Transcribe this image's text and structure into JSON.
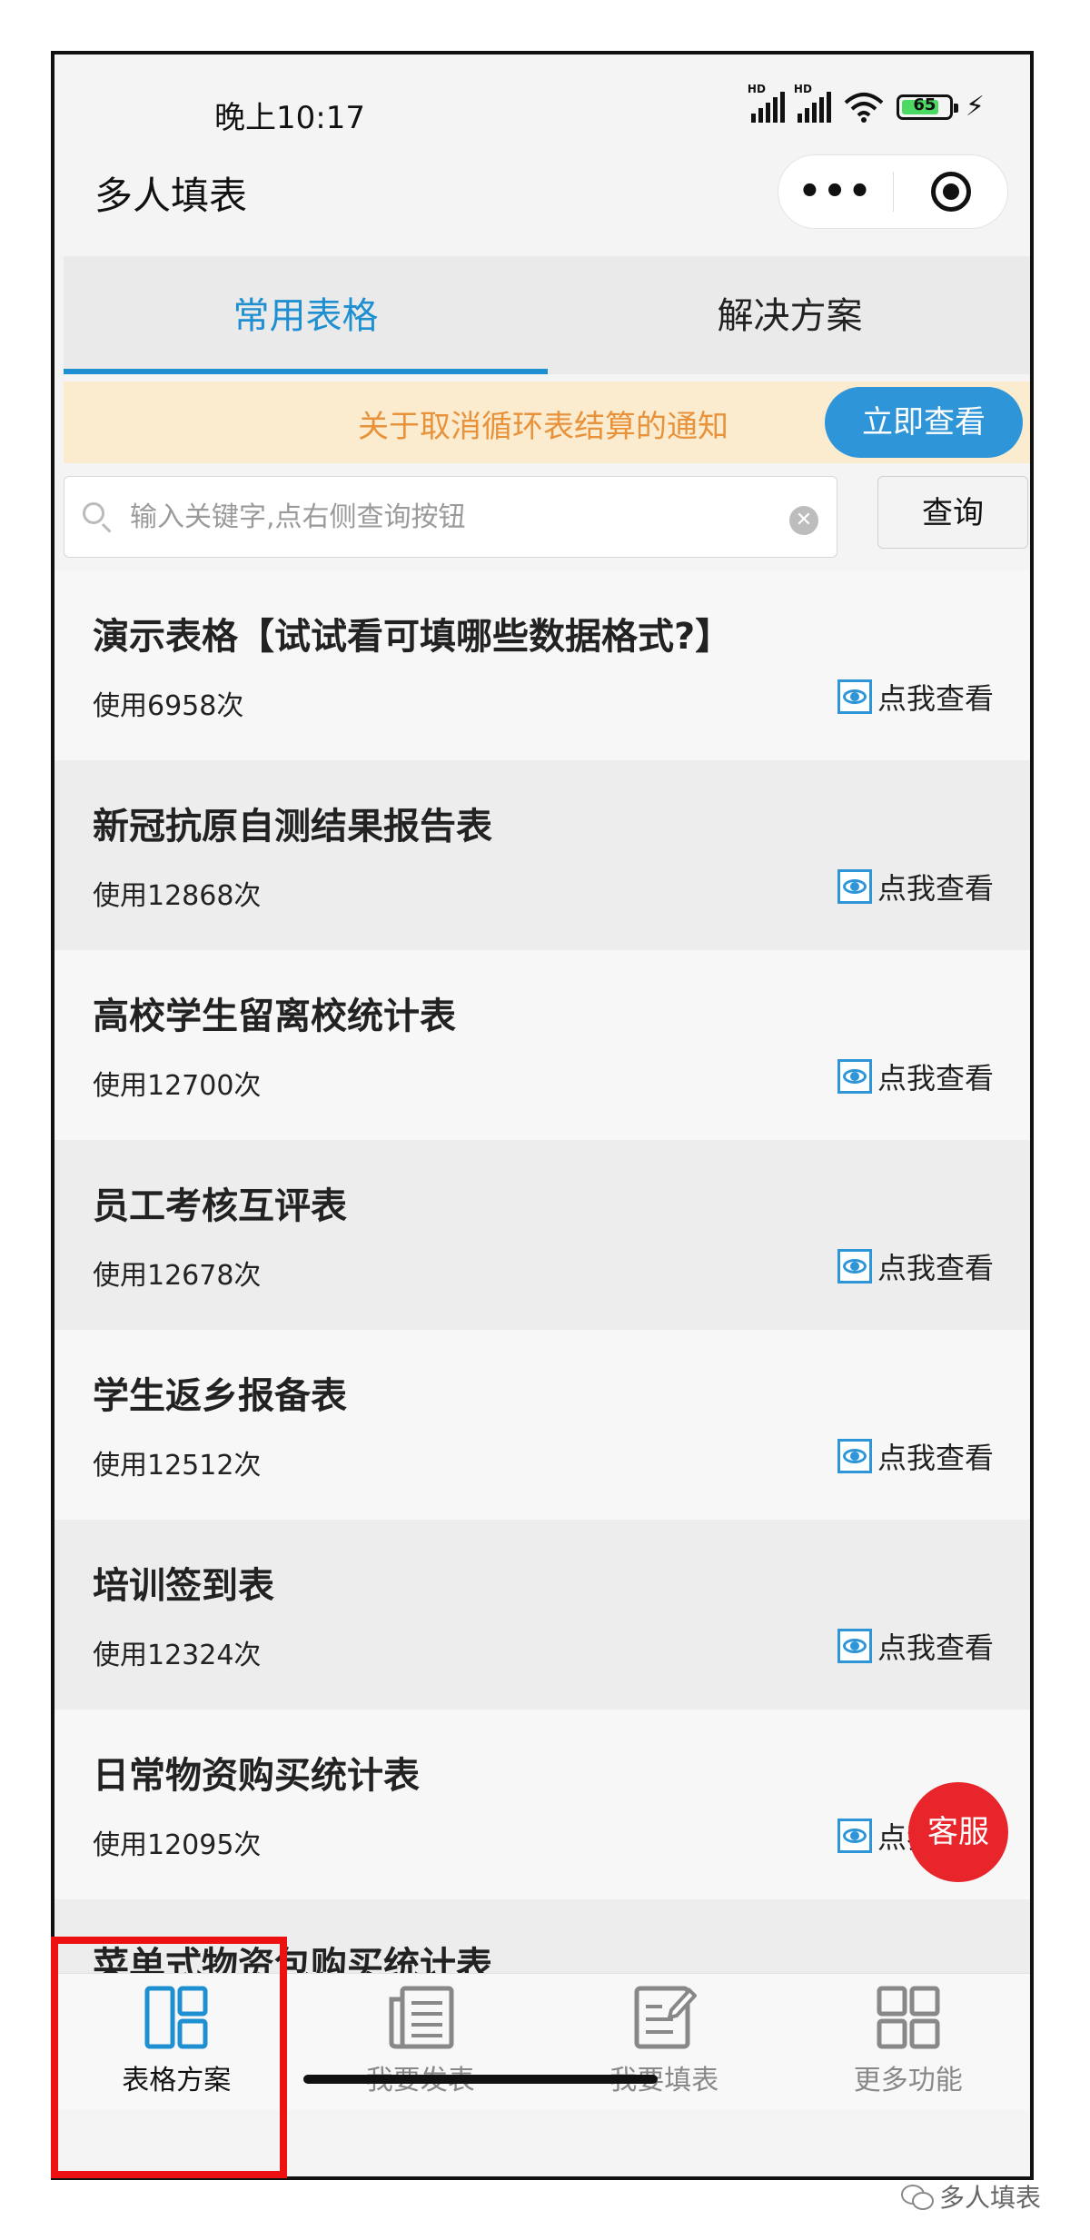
{
  "status": {
    "time": "晚上10:17",
    "battery": "65",
    "hd_label": "HD"
  },
  "navbar": {
    "title": "多人填表",
    "more_icon": "more-dots-icon",
    "close_icon": "target-icon"
  },
  "tabs": [
    {
      "label": "常用表格",
      "active": true
    },
    {
      "label": "解决方案",
      "active": false
    }
  ],
  "notice": {
    "text": "关于取消循环表结算的通知",
    "button": "立即查看"
  },
  "search": {
    "placeholder": "输入关键字,点右侧查询按钮",
    "button": "查询"
  },
  "items": [
    {
      "title": "演示表格【试试看可填哪些数据格式?】",
      "count": "使用6958次",
      "view": "点我查看"
    },
    {
      "title": "新冠抗原自测结果报告表",
      "count": "使用12868次",
      "view": "点我查看"
    },
    {
      "title": "高校学生留离校统计表",
      "count": "使用12700次",
      "view": "点我查看"
    },
    {
      "title": "员工考核互评表",
      "count": "使用12678次",
      "view": "点我查看"
    },
    {
      "title": "学生返乡报备表",
      "count": "使用12512次",
      "view": "点我查看"
    },
    {
      "title": "培训签到表",
      "count": "使用12324次",
      "view": "点我查看"
    },
    {
      "title": "日常物资购买统计表",
      "count": "使用12095次",
      "view": "点我查看"
    },
    {
      "title": "菜单式物资包购买统计表",
      "count": "",
      "view": ""
    }
  ],
  "kefu": "客服",
  "tabbar": [
    {
      "label": "表格方案",
      "icon": "layout-icon",
      "active": true
    },
    {
      "label": "我要发表",
      "icon": "newspaper-icon",
      "active": false
    },
    {
      "label": "我要填表",
      "icon": "edit-form-icon",
      "active": false
    },
    {
      "label": "更多功能",
      "icon": "grid-icon",
      "active": false
    }
  ],
  "watermark": "多人填表",
  "colors": {
    "accent": "#1e8fd0",
    "notice_bg": "#fbecd0",
    "notice_text": "#e8933b",
    "kefu": "#e8252a",
    "highlight": "#ee1111"
  }
}
